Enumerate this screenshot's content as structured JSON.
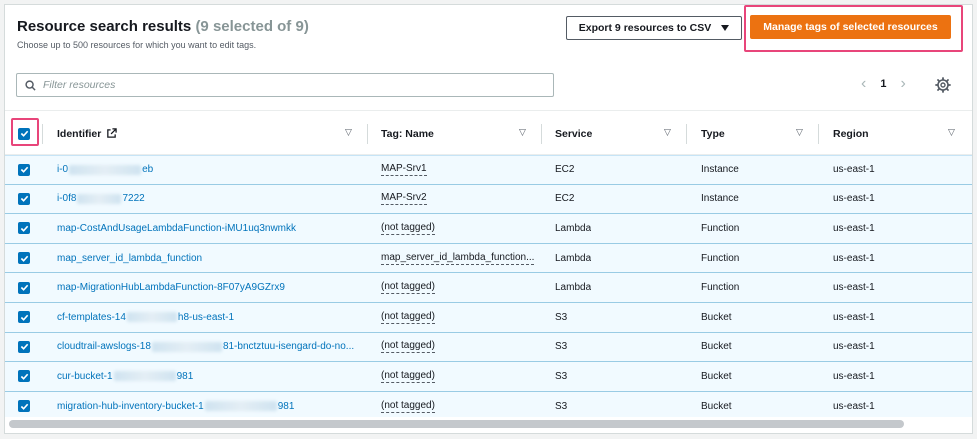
{
  "header": {
    "title": "Resource search results",
    "count": "(9 selected of 9)",
    "subtitle": "Choose up to 500 resources for which you want to edit tags.",
    "export_label": "Export 9 resources to CSV",
    "manage_label": "Manage tags of selected resources"
  },
  "filter": {
    "placeholder": "Filter resources"
  },
  "pagination": {
    "page": "1"
  },
  "columns": {
    "identifier": "Identifier",
    "tag_name": "Tag: Name",
    "service": "Service",
    "type": "Type",
    "region": "Region"
  },
  "rows": [
    {
      "id_pre": "i-0",
      "id_post": "eb",
      "tag": "MAP-Srv1",
      "service": "EC2",
      "type": "Instance",
      "region": "us-east-1"
    },
    {
      "id_pre": "i-0f8",
      "id_post": "7222",
      "tag": "MAP-Srv2",
      "service": "EC2",
      "type": "Instance",
      "region": "us-east-1"
    },
    {
      "id": "map-CostAndUsageLambdaFunction-iMU1uq3nwmkk",
      "tag": "(not tagged)",
      "service": "Lambda",
      "type": "Function",
      "region": "us-east-1"
    },
    {
      "id": "map_server_id_lambda_function",
      "tag": "map_server_id_lambda_function...",
      "service": "Lambda",
      "type": "Function",
      "region": "us-east-1"
    },
    {
      "id": "map-MigrationHubLambdaFunction-8F07yA9GZrx9",
      "tag": "(not tagged)",
      "service": "Lambda",
      "type": "Function",
      "region": "us-east-1"
    },
    {
      "id_pre": "cf-templates-14",
      "id_post": "h8-us-east-1",
      "tag": "(not tagged)",
      "service": "S3",
      "type": "Bucket",
      "region": "us-east-1"
    },
    {
      "id_pre": "cloudtrail-awslogs-18",
      "id_post": "81-bnctztuu-isengard-do-no...",
      "tag": "(not tagged)",
      "service": "S3",
      "type": "Bucket",
      "region": "us-east-1"
    },
    {
      "id_pre": "cur-bucket-1",
      "id_post": "981",
      "tag": "(not tagged)",
      "service": "S3",
      "type": "Bucket",
      "region": "us-east-1"
    },
    {
      "id_pre": "migration-hub-inventory-bucket-1",
      "id_post": "981",
      "tag": "(not tagged)",
      "service": "S3",
      "type": "Bucket",
      "region": "us-east-1"
    }
  ],
  "colors": {
    "accent": "#ec7211",
    "link": "#0073bb",
    "highlight": "#e8457a"
  }
}
